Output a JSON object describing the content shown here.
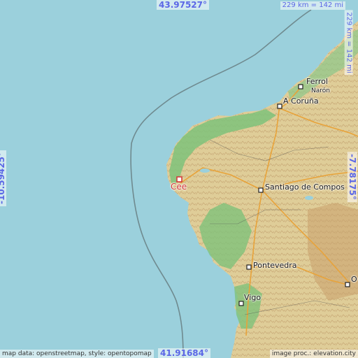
{
  "map": {
    "coords": {
      "north": "43.97527°",
      "south": "41.91684°",
      "west": "-10.59425°",
      "east": "-7.78175°"
    },
    "scale": {
      "horizontal": "229 km = 142 mi",
      "vertical": "229 km = 142 mi"
    },
    "cities": [
      {
        "name": "Ferrol",
        "type": "city"
      },
      {
        "name": "Narón",
        "type": "town"
      },
      {
        "name": "A Coruña",
        "type": "city"
      },
      {
        "name": "Cee",
        "type": "highlight"
      },
      {
        "name": "Santiago de Compos",
        "type": "city"
      },
      {
        "name": "Pontevedra",
        "type": "city"
      },
      {
        "name": "Vigo",
        "type": "city"
      },
      {
        "name": "O",
        "type": "city"
      }
    ],
    "attribution": {
      "left": "map data: openstreetmap, style: opentopomap",
      "right": "image proc.: elevation.city"
    },
    "colors": {
      "sea": "#9bd0dc",
      "land": "#e0cf9b",
      "lowland": "#7fc27a",
      "coord_text": "#5b67e6",
      "marker": "#d23a3a"
    }
  }
}
